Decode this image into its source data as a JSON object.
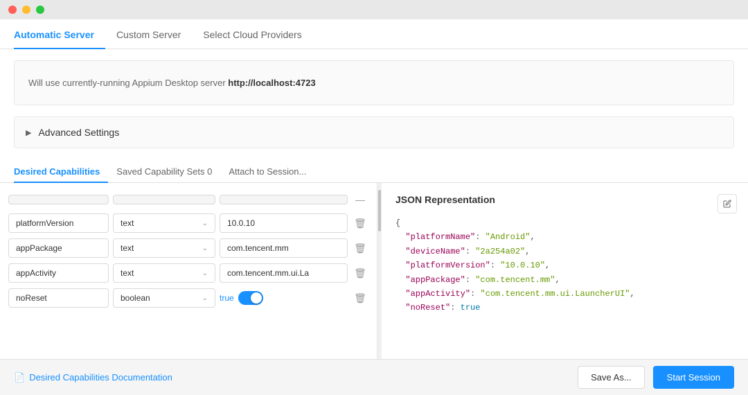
{
  "titleBar": {
    "buttons": [
      "close",
      "minimize",
      "maximize"
    ]
  },
  "tabs": [
    {
      "id": "automatic",
      "label": "Automatic Server",
      "active": true
    },
    {
      "id": "custom",
      "label": "Custom Server",
      "active": false
    },
    {
      "id": "cloud",
      "label": "Select Cloud Providers",
      "active": false
    }
  ],
  "infoBanner": {
    "text": "Will use currently-running Appium Desktop server ",
    "url": "http://localhost:4723"
  },
  "advancedSettings": {
    "label": "Advanced Settings"
  },
  "subTabs": [
    {
      "id": "desired",
      "label": "Desired Capabilities",
      "active": true
    },
    {
      "id": "saved",
      "label": "Saved Capability Sets 0",
      "active": false
    },
    {
      "id": "attach",
      "label": "Attach to Session...",
      "active": false
    }
  ],
  "jsonPanel": {
    "title": "JSON Representation",
    "content": "{\n  \"platformName\": \"Android\",\n  \"deviceName\": \"2a254a02\",\n  \"platformVersion\": \"10.0.10\",\n  \"appPackage\": \"com.tencent.mm\",\n  \"appActivity\": \"com.tencent.mm.ui.LauncherUI\",\n  \"noReset\": true"
  },
  "capabilities": [
    {
      "name": "platformVersion",
      "type": "text",
      "value": "10.0.10"
    },
    {
      "name": "appPackage",
      "type": "text",
      "value": "com.tencent.mm"
    },
    {
      "name": "appActivity",
      "type": "text",
      "value": "com.tencent.mm.ui.La"
    },
    {
      "name": "noReset",
      "type": "boolean",
      "value": "true",
      "isToggle": true
    }
  ],
  "bottomBar": {
    "docsLink": "Desired Capabilities Documentation",
    "saveAsLabel": "Save As...",
    "startSessionLabel": "Start Session"
  }
}
